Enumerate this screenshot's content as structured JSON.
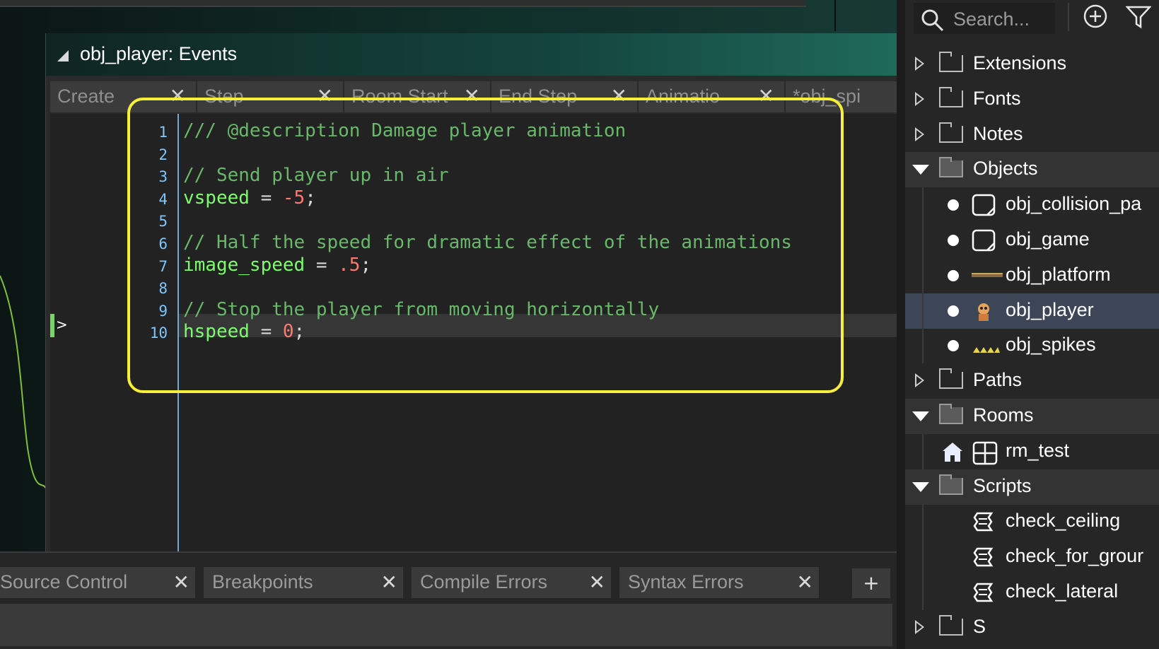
{
  "window": {
    "title": "obj_player: Events",
    "event_tabs": [
      {
        "label": "Create"
      },
      {
        "label": "Step"
      },
      {
        "label": "Room Start"
      },
      {
        "label": "End Step"
      },
      {
        "label": "Animatio"
      },
      {
        "label": "*obj_spi"
      }
    ]
  },
  "editor": {
    "line_numbers": [
      "1",
      "2",
      "3",
      "4",
      "5",
      "6",
      "7",
      "8",
      "9",
      "10"
    ],
    "lines": [
      [
        {
          "t": "/// @description Damage player animation",
          "k": "comment"
        }
      ],
      [],
      [
        {
          "t": "// Send player up in air",
          "k": "comment"
        }
      ],
      [
        {
          "t": "vspeed",
          "k": "var"
        },
        {
          "t": " = ",
          "k": "op"
        },
        {
          "t": "-5",
          "k": "num"
        },
        {
          "t": ";",
          "k": "op"
        }
      ],
      [],
      [
        {
          "t": "// Half the speed for dramatic effect of the animations",
          "k": "comment"
        }
      ],
      [
        {
          "t": "image_speed",
          "k": "var"
        },
        {
          "t": " = ",
          "k": "op"
        },
        {
          "t": ".5",
          "k": "num"
        },
        {
          "t": ";",
          "k": "op"
        }
      ],
      [],
      [
        {
          "t": "// Stop the player from moving horizontally",
          "k": "comment"
        }
      ],
      [
        {
          "t": "hspeed",
          "k": "var"
        },
        {
          "t": " = ",
          "k": "op"
        },
        {
          "t": "0",
          "k": "num"
        },
        {
          "t": ";",
          "k": "op"
        }
      ]
    ],
    "current_line": 10,
    "colors": {
      "comment": "#68b86a",
      "var": "#7cff6b",
      "num": "#ff7a70",
      "highlight": "#f6f03a"
    }
  },
  "bottom_tabs": [
    {
      "label": "Source Control"
    },
    {
      "label": "Breakpoints"
    },
    {
      "label": "Compile Errors"
    },
    {
      "label": "Syntax Errors"
    }
  ],
  "bottom_add_label": "+",
  "resources": {
    "search_placeholder": "Search...",
    "tree": [
      {
        "label": "Extensions",
        "kind": "group",
        "open": false
      },
      {
        "label": "Fonts",
        "kind": "group",
        "open": false
      },
      {
        "label": "Notes",
        "kind": "group",
        "open": false
      },
      {
        "label": "Objects",
        "kind": "group",
        "open": true
      },
      {
        "label": "obj_collision_pa",
        "kind": "object",
        "icon": "object-icon"
      },
      {
        "label": "obj_game",
        "kind": "object",
        "icon": "object-icon"
      },
      {
        "label": "obj_platform",
        "kind": "object",
        "icon": "platform-sprite-icon"
      },
      {
        "label": "obj_player",
        "kind": "object",
        "icon": "player-sprite-icon",
        "selected": true
      },
      {
        "label": "obj_spikes",
        "kind": "object",
        "icon": "spikes-sprite-icon"
      },
      {
        "label": "Paths",
        "kind": "group",
        "open": false
      },
      {
        "label": "Rooms",
        "kind": "group",
        "open": true
      },
      {
        "label": "rm_test",
        "kind": "room",
        "icon": "room-icon"
      },
      {
        "label": "Scripts",
        "kind": "group",
        "open": true
      },
      {
        "label": "check_ceiling",
        "kind": "script",
        "icon": "script-icon"
      },
      {
        "label": "check_for_grour",
        "kind": "script",
        "icon": "script-icon"
      },
      {
        "label": "check_lateral",
        "kind": "script",
        "icon": "script-icon"
      },
      {
        "label": "S",
        "kind": "group",
        "open": false
      }
    ]
  }
}
